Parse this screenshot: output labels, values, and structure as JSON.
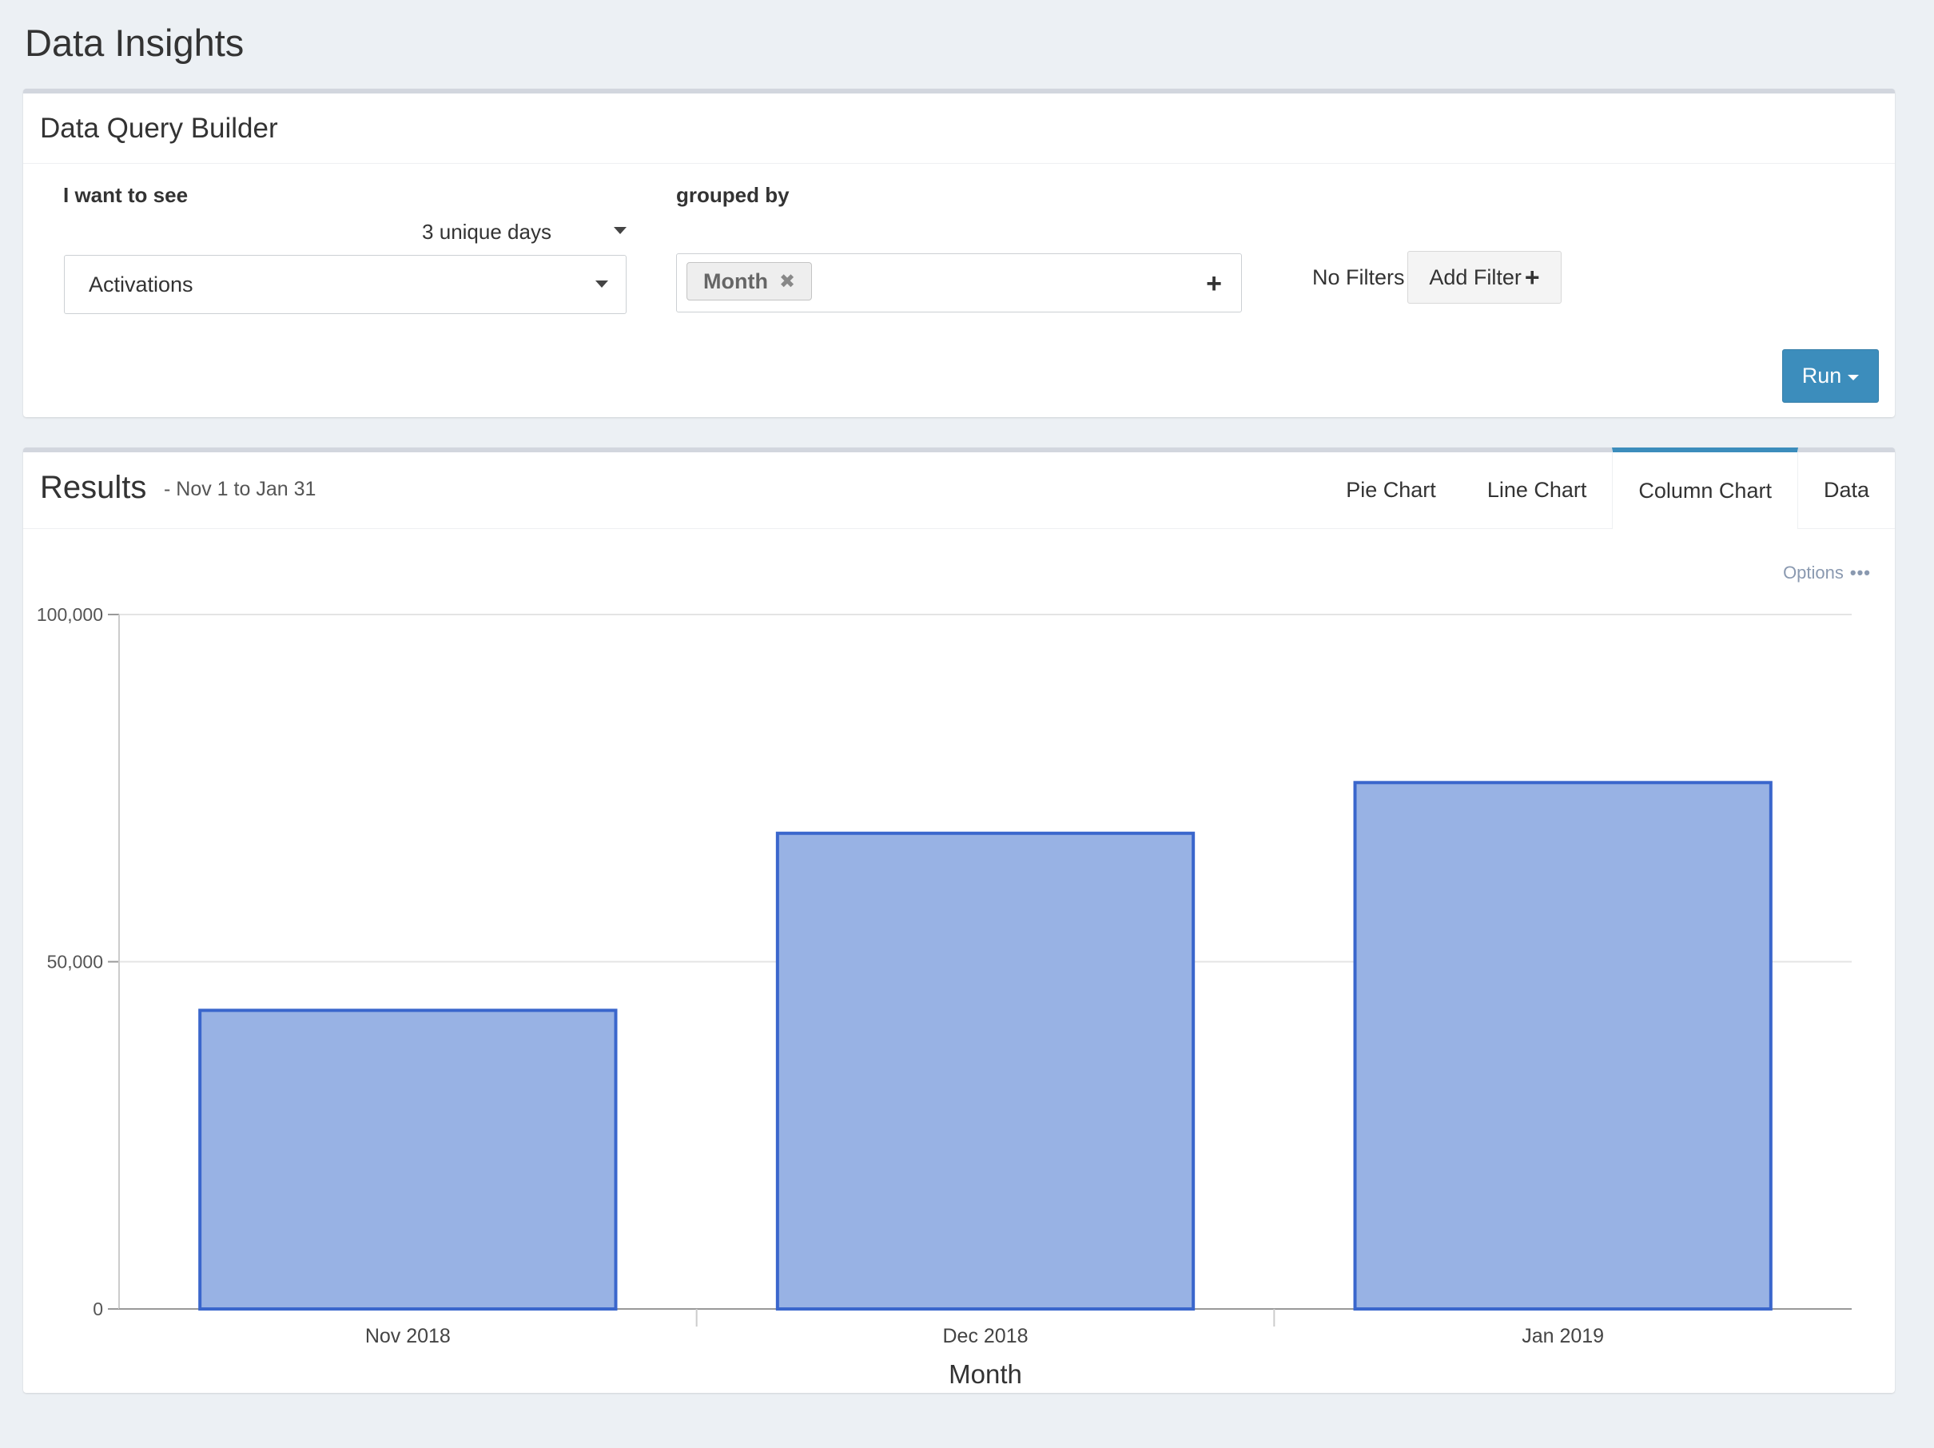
{
  "page": {
    "title": "Data Insights"
  },
  "query_builder": {
    "title": "Data Query Builder",
    "want_label": "I want to see",
    "unique_days": "3 unique days",
    "metric": "Activations",
    "grouped_label": "grouped by",
    "group_tag": "Month",
    "no_filters": "No Filters",
    "add_filter_label": "Add Filter",
    "run_label": "Run"
  },
  "results": {
    "title": "Results",
    "subtitle": "- Nov 1 to Jan 31",
    "tabs": [
      "Pie Chart",
      "Line Chart",
      "Column Chart",
      "Data"
    ],
    "active_tab": "Column Chart",
    "options_label": "Options"
  },
  "chart_data": {
    "type": "bar",
    "categories": [
      "Nov 2018",
      "Dec 2018",
      "Jan 2019"
    ],
    "values": [
      43000,
      68500,
      75800
    ],
    "xlabel": "Month",
    "ylabel": "",
    "ylim": [
      0,
      100000
    ],
    "yticks": [
      "0",
      "50,000",
      "100,000"
    ],
    "grid": true,
    "bar_fill": "#98b2e4",
    "bar_stroke": "#3a66cc"
  }
}
